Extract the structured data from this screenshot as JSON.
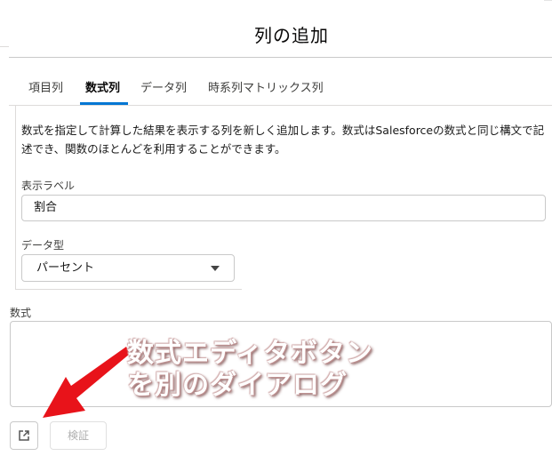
{
  "dialog": {
    "title": "列の追加"
  },
  "tabs": [
    {
      "label": "項目列",
      "active": false
    },
    {
      "label": "数式列",
      "active": true
    },
    {
      "label": "データ列",
      "active": false
    },
    {
      "label": "時系列マトリックス列",
      "active": false
    }
  ],
  "description": "数式を指定して計算した結果を表示する列を新しく追加します。数式はSalesforceの数式と同じ構文で記述でき、関数のほとんどを利用することができます。",
  "form": {
    "display_label": {
      "label": "表示ラベル",
      "value": "割合"
    },
    "data_type": {
      "label": "データ型",
      "value": "パーセント"
    },
    "formula": {
      "label": "数式",
      "value": ""
    }
  },
  "buttons": {
    "verify_label": "検証"
  },
  "icons": {
    "formula_editor": "external-link-icon",
    "data_type_caret": "caret-down-icon"
  },
  "annotation": {
    "line1": "数式エディタボタン",
    "line2": "を別のダイアログ"
  },
  "colors": {
    "accent": "#0176d3",
    "arrow": "#e8131a"
  }
}
